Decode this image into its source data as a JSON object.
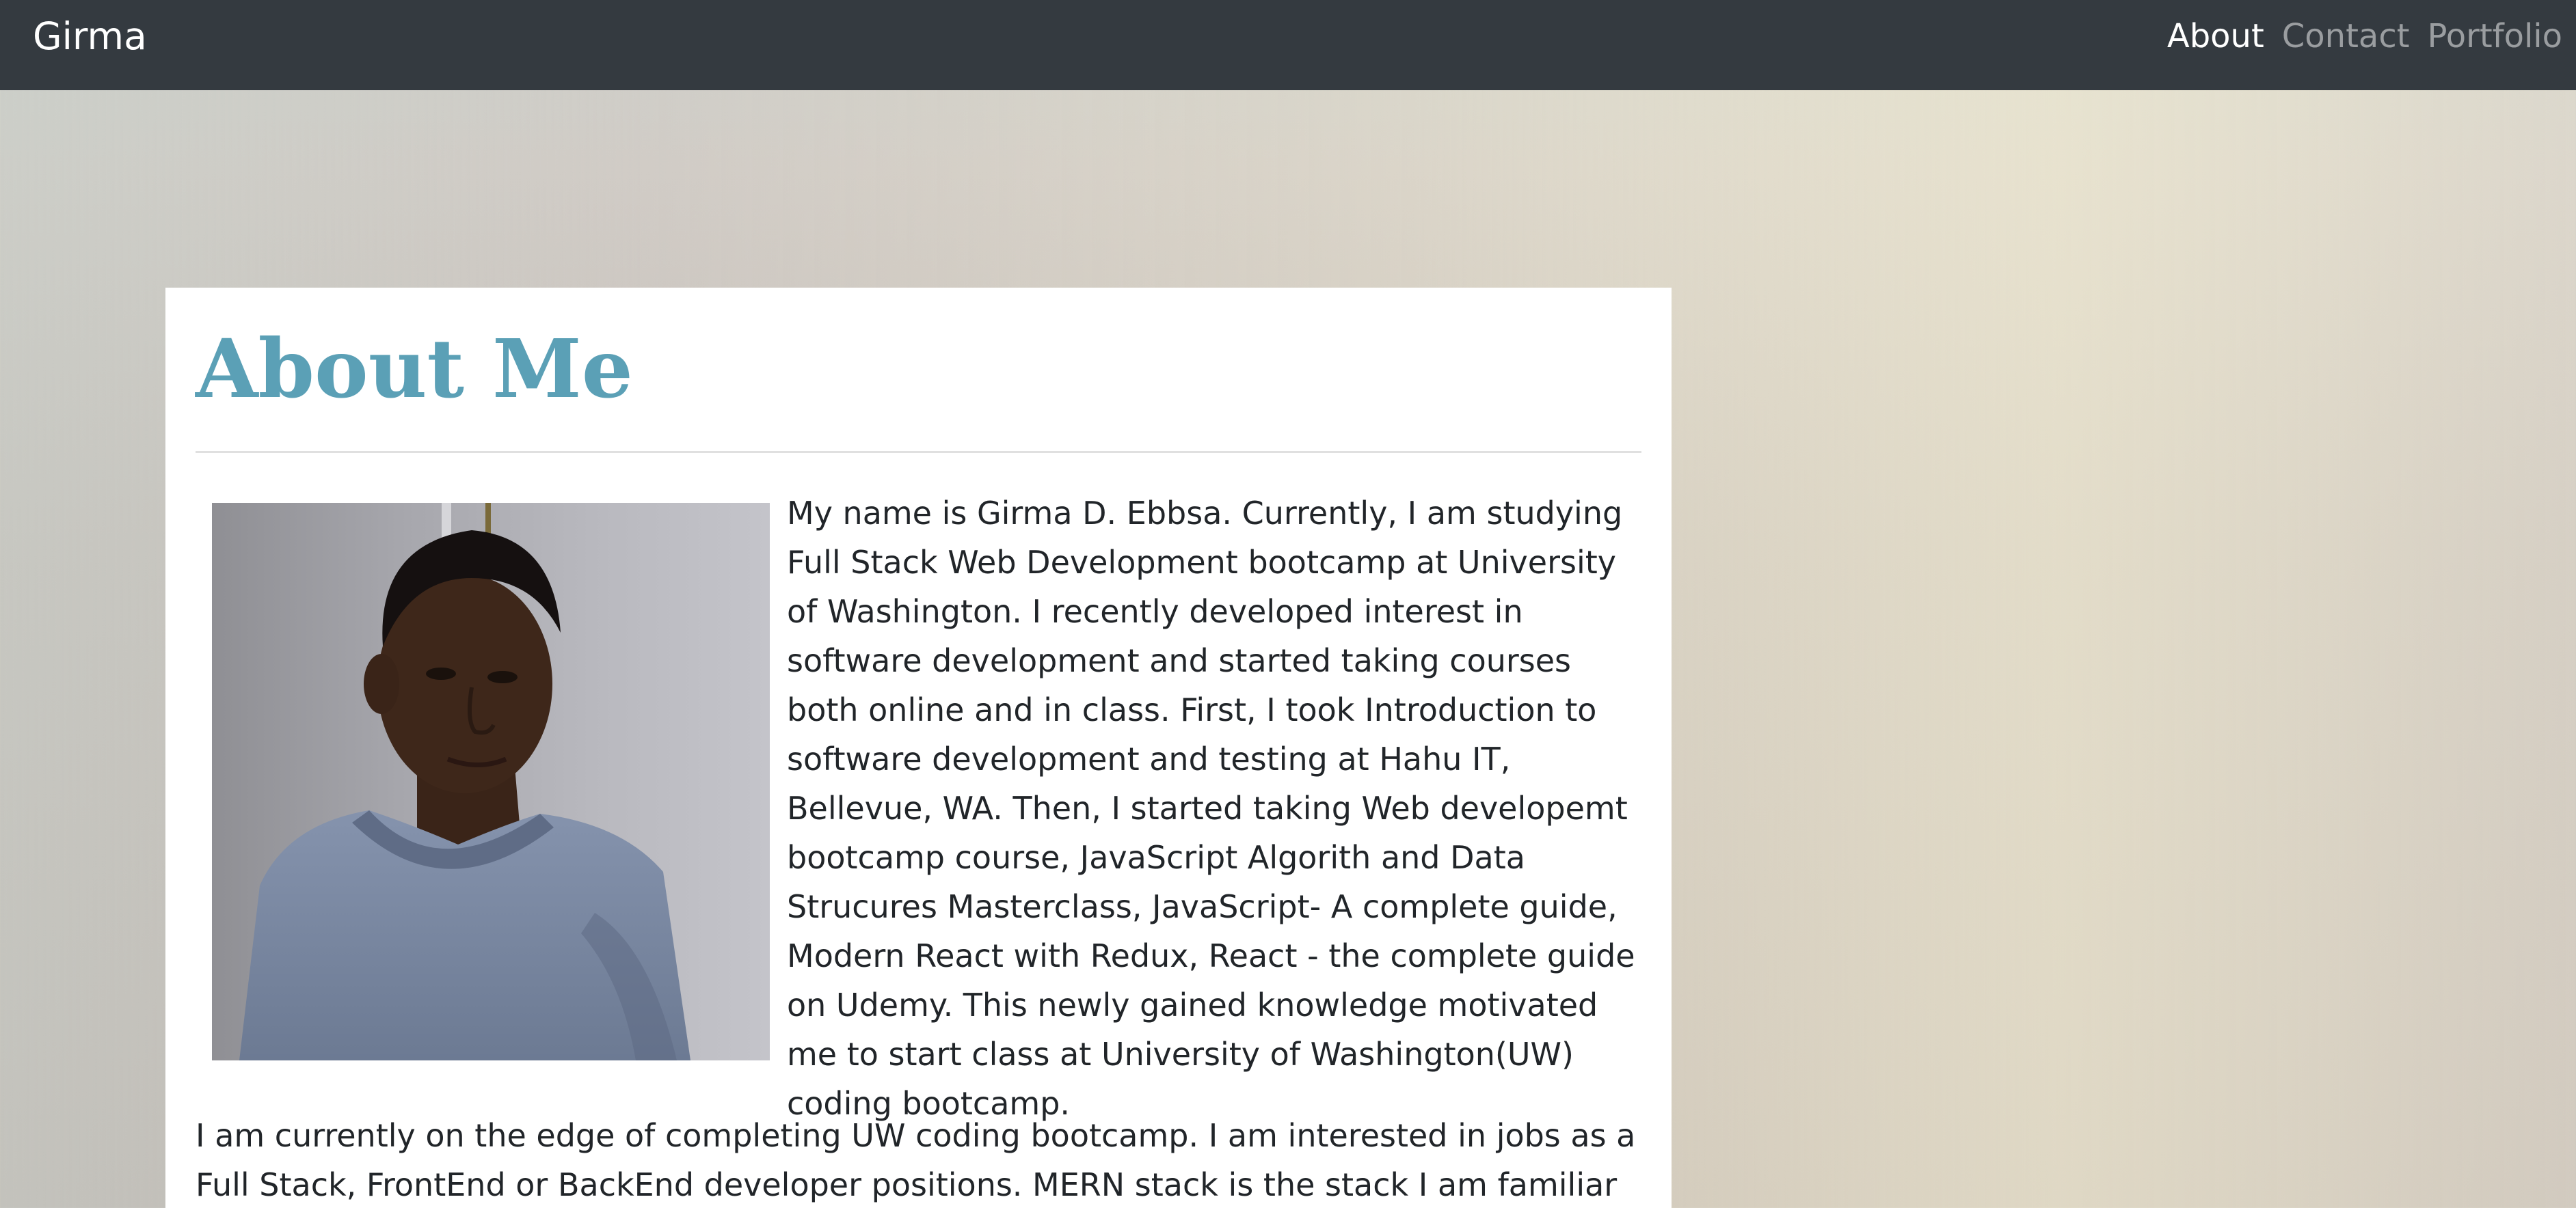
{
  "navbar": {
    "brand": "Girma",
    "links": [
      {
        "label": "About",
        "active": true
      },
      {
        "label": "Contact",
        "active": false
      },
      {
        "label": "Portfolio",
        "active": false
      }
    ]
  },
  "main": {
    "title": "About Me",
    "paragraphs": [
      "My name is Girma D. Ebbsa. Currently, I am studying Full Stack Web Development bootcamp at University of Washington. I recently developed interest in software development and started taking courses both online and in class. First, I took Introduction to software development and testing at Hahu IT, Bellevue, WA. Then, I started taking Web developemt bootcamp course, JavaScript Algorith and Data Strucures Masterclass, JavaScript- A complete guide, Modern React with Redux, React - the complete guide on Udemy. This newly gained knowledge motivated me to start class at University of Washington(UW) coding bootcamp.",
      "I am currently on the edge of completing UW coding bootcamp. I am interested in jobs as a Full Stack, FrontEnd or BackEnd developer positions. MERN stack is the stack I am familiar with,"
    ]
  },
  "colors": {
    "navbar_bg": "#343a40",
    "title": "#5ba0b6",
    "text": "#212529"
  }
}
